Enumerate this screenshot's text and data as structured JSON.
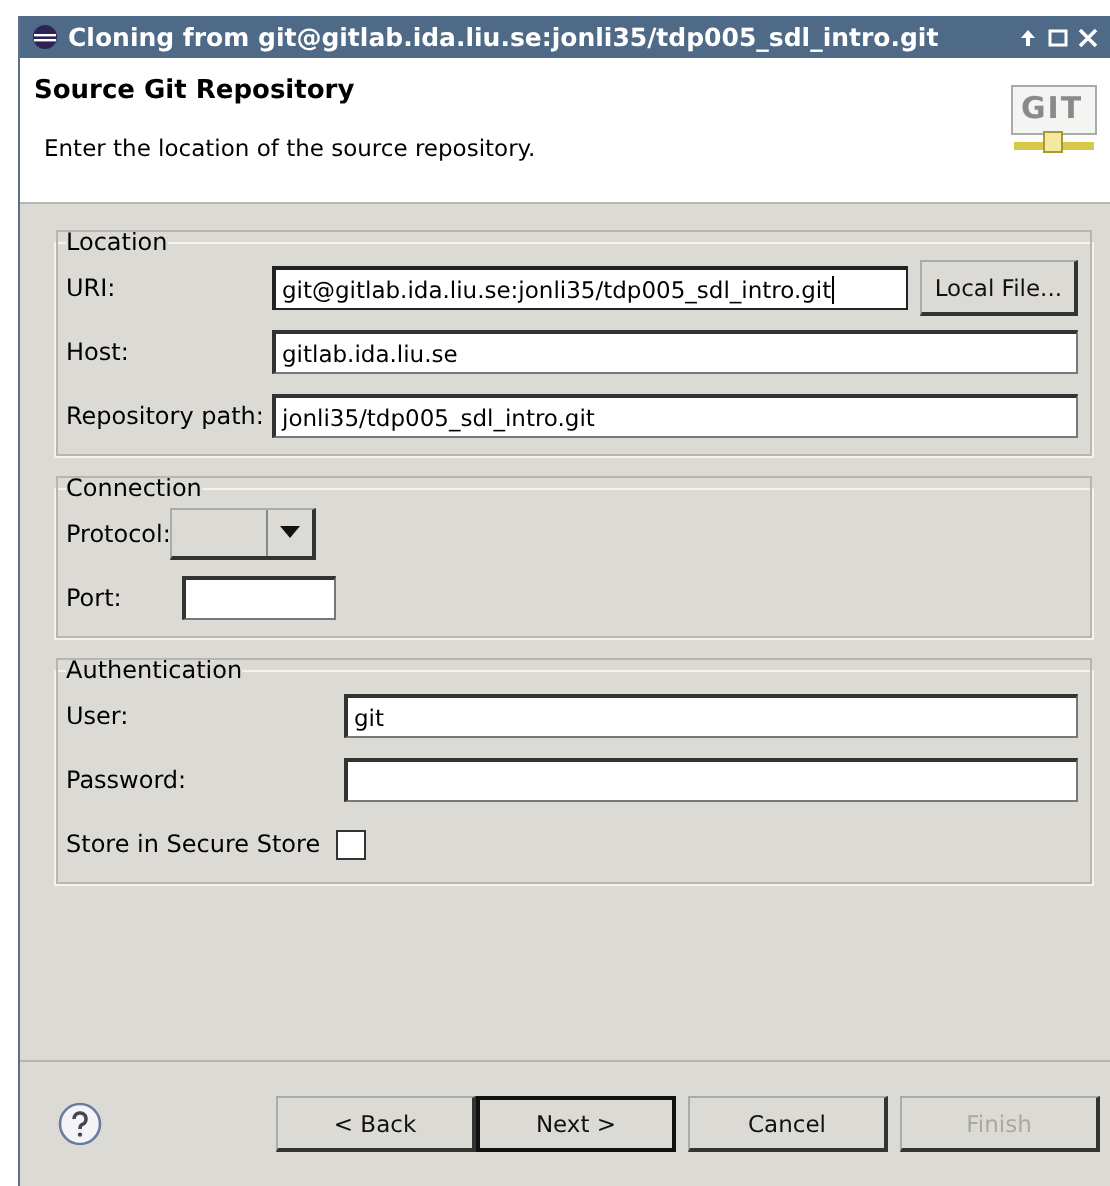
{
  "window": {
    "title": "Cloning from git@gitlab.ida.liu.se:jonli35/tdp005_sdl_intro.git"
  },
  "header": {
    "title": "Source Git Repository",
    "description": "Enter the location of the source repository.",
    "logo": "GIT"
  },
  "groups": [
    {
      "title": "Location",
      "rows": [
        {
          "kind": "text",
          "label": "URI:",
          "value": "git@gitlab.ida.liu.se:jonli35/tdp005_sdl_intro.git",
          "focused": true,
          "button": "Local File..."
        },
        {
          "kind": "text",
          "label": "Host:",
          "value": "gitlab.ida.liu.se",
          "focused": false
        },
        {
          "kind": "text",
          "label": "Repository path:",
          "value": "jonli35/tdp005_sdl_intro.git",
          "focused": false
        }
      ]
    },
    {
      "title": "Connection",
      "rows": [
        {
          "kind": "combo",
          "label": "Protocol:"
        },
        {
          "kind": "short",
          "label": "Port:"
        }
      ]
    },
    {
      "title": "Authentication",
      "rows": [
        {
          "kind": "text",
          "label": "User:",
          "value": "git",
          "focused": false
        },
        {
          "kind": "text",
          "label": "Password:",
          "value": "",
          "focused": false
        },
        {
          "kind": "check",
          "label": "Store in Secure Store",
          "checked": false
        }
      ]
    }
  ],
  "buttons": [
    {
      "label": "< Back",
      "default": false,
      "disabled": false
    },
    {
      "label": "Next >",
      "default": true,
      "disabled": false
    },
    {
      "label": "Cancel",
      "default": false,
      "disabled": false
    },
    {
      "label": "Finish",
      "default": false,
      "disabled": true
    }
  ]
}
